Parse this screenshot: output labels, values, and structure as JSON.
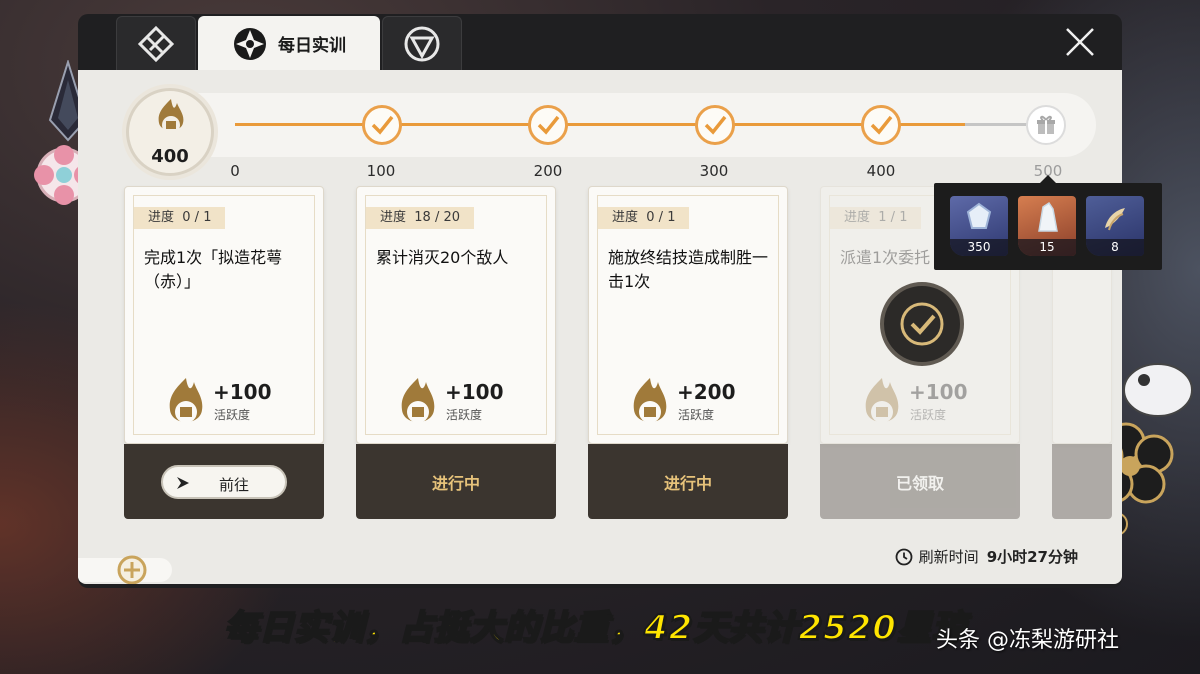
{
  "tabs": [
    {
      "label": "",
      "icon": "crossed-diamond-icon"
    },
    {
      "label": "每日实训",
      "icon": "compass-cross-icon"
    },
    {
      "label": "",
      "icon": "triangle-badge-icon"
    }
  ],
  "progress": {
    "current_score": "400",
    "milestones": [
      "0",
      "100",
      "200",
      "300",
      "400",
      "500"
    ],
    "completed_count": 4
  },
  "reward_popup": {
    "items": [
      {
        "name": "stellar-jade",
        "count": "350"
      },
      {
        "name": "crystal",
        "count": "15"
      },
      {
        "name": "credit-feathers",
        "count": "8"
      }
    ]
  },
  "tasks": [
    {
      "progress_label": "进度",
      "progress_value": "0 / 1",
      "text": "完成1次「拟造花萼（赤）」",
      "reward": "+100",
      "reward_label": "活跃度",
      "status": "前往",
      "state": "go"
    },
    {
      "progress_label": "进度",
      "progress_value": "18 / 20",
      "text": "累计消灭20个敌人",
      "reward": "+100",
      "reward_label": "活跃度",
      "status": "进行中",
      "state": "in-progress"
    },
    {
      "progress_label": "进度",
      "progress_value": "0 / 1",
      "text": "施放终结技造成制胜一击1次",
      "reward": "+200",
      "reward_label": "活跃度",
      "status": "进行中",
      "state": "in-progress"
    },
    {
      "progress_label": "进度",
      "progress_value": "1 / 1",
      "text": "派遣1次委托",
      "reward": "+100",
      "reward_label": "活跃度",
      "status": "已领取",
      "state": "claimed"
    }
  ],
  "refresh": {
    "label": "刷新时间",
    "value": "9小时27分钟"
  },
  "caption": "每日实训，占挺大的比重，42天共计2520星琼",
  "watermark": "头条 @冻梨游研社",
  "colors": {
    "accent": "#e99a3a",
    "card_footer": "#3b352f",
    "caption": "#ffe500"
  }
}
